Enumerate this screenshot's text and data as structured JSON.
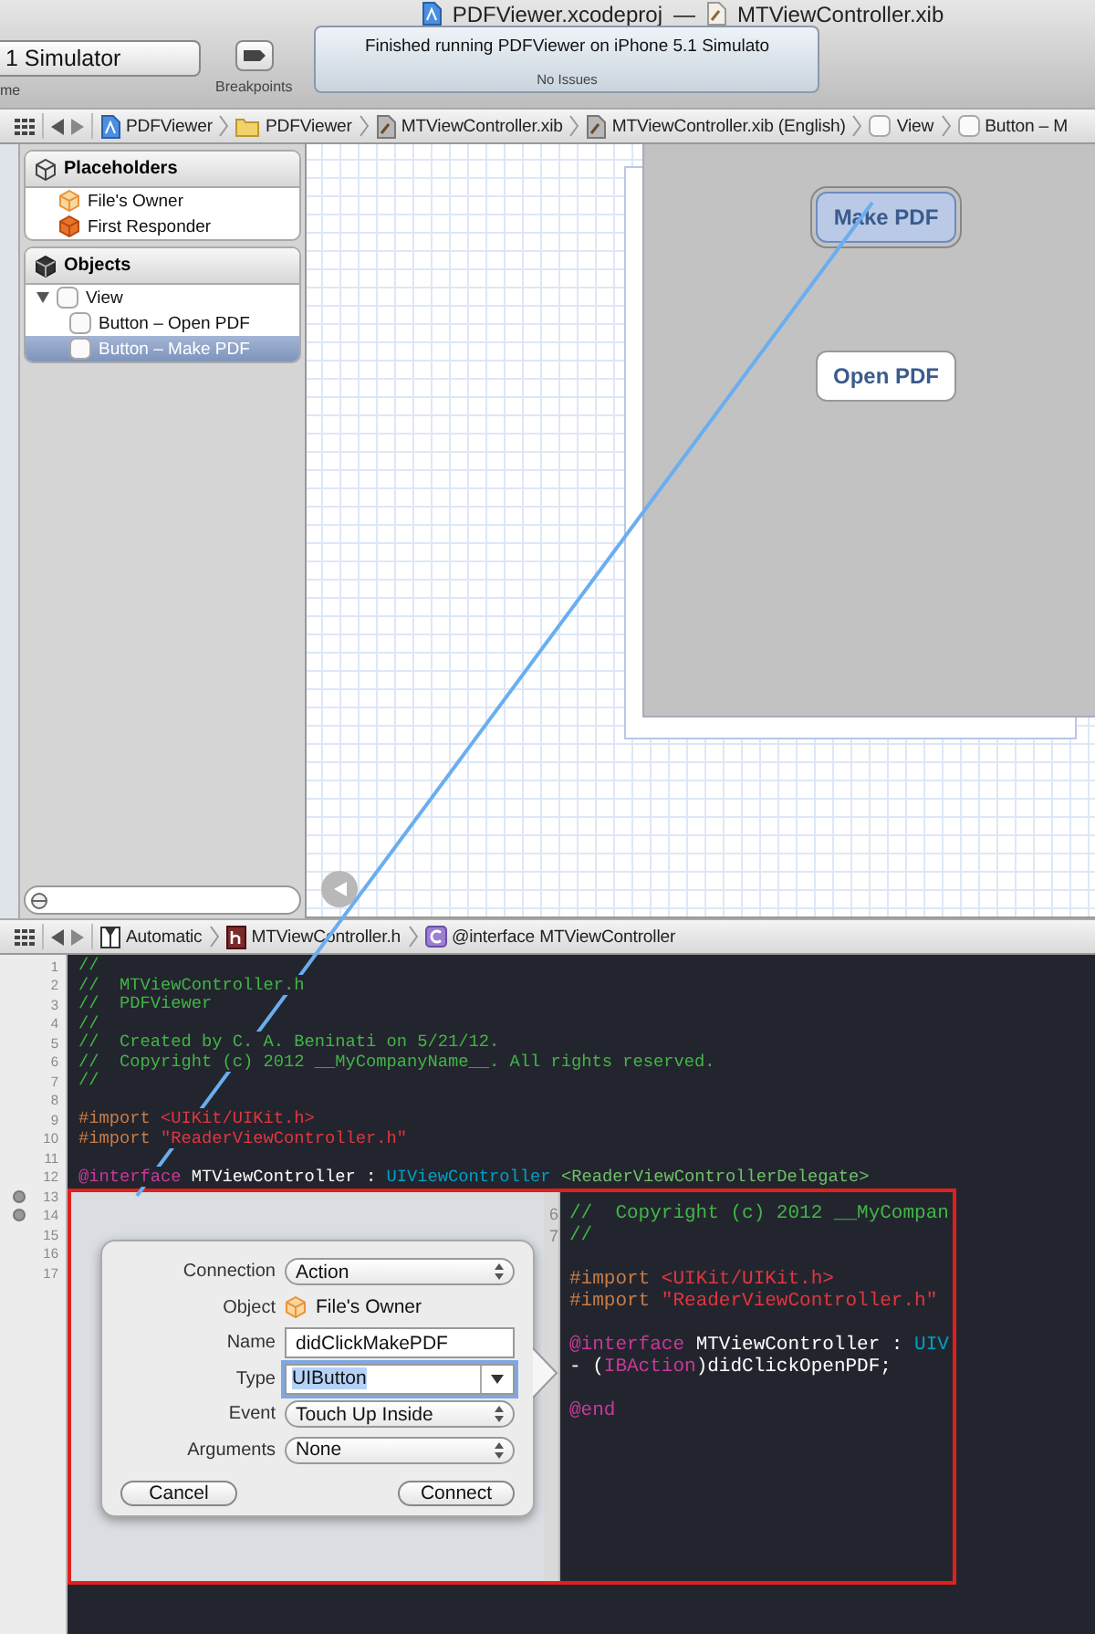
{
  "window": {
    "title_project": "PDFViewer.xcodeproj",
    "title_separator": "—",
    "title_file": "MTViewController.xib"
  },
  "toolbar": {
    "scheme": "1 Simulator",
    "scheme_caption": "me",
    "breakpoints_caption": "Breakpoints",
    "status": {
      "message": "Finished running PDFViewer on iPhone 5.1 Simulato",
      "issues": "No Issues"
    }
  },
  "jump_bar": [
    {
      "label": "PDFViewer"
    },
    {
      "label": "PDFViewer"
    },
    {
      "label": "MTViewController.xib"
    },
    {
      "label": "MTViewController.xib (English)"
    },
    {
      "label": "View"
    },
    {
      "label": "Button – M"
    }
  ],
  "outline": {
    "sections": [
      {
        "title": "Placeholders",
        "items": [
          {
            "label": "File's Owner",
            "selected": false
          },
          {
            "label": "First Responder",
            "selected": false
          }
        ]
      },
      {
        "title": "Objects",
        "items": [
          {
            "label": "View",
            "selected": false,
            "expanded": true,
            "children": [
              {
                "label": "Button – Open PDF",
                "selected": false
              },
              {
                "label": "Button – Make PDF",
                "selected": true
              }
            ]
          }
        ]
      }
    ]
  },
  "canvas": {
    "buttons": [
      {
        "label": "Make PDF",
        "selected": true
      },
      {
        "label": "Open PDF",
        "selected": false
      }
    ]
  },
  "editor_jump_bar": [
    {
      "label": "Automatic"
    },
    {
      "label": "MTViewController.h"
    },
    {
      "label": "@interface MTViewController"
    }
  ],
  "editor": {
    "lines": [
      {
        "number": "1",
        "breakpoint": false,
        "segments": [
          {
            "kind": "comment",
            "text": "//"
          }
        ]
      },
      {
        "number": "2",
        "breakpoint": false,
        "segments": [
          {
            "kind": "comment",
            "text": "//  MTViewController.h"
          }
        ]
      },
      {
        "number": "3",
        "breakpoint": false,
        "segments": [
          {
            "kind": "comment",
            "text": "//  PDFViewer"
          }
        ]
      },
      {
        "number": "4",
        "breakpoint": false,
        "segments": [
          {
            "kind": "comment",
            "text": "//"
          }
        ]
      },
      {
        "number": "5",
        "breakpoint": false,
        "segments": [
          {
            "kind": "comment",
            "text": "//  Created by C. A. Beninati on 5/21/12."
          }
        ]
      },
      {
        "number": "6",
        "breakpoint": false,
        "segments": [
          {
            "kind": "comment",
            "text": "//  Copyright (c) 2012 __MyCompanyName__. All rights reserved."
          }
        ]
      },
      {
        "number": "7",
        "breakpoint": false,
        "segments": [
          {
            "kind": "comment",
            "text": "//"
          }
        ]
      },
      {
        "number": "8",
        "breakpoint": false
      },
      {
        "number": "9",
        "breakpoint": false,
        "segments": [
          {
            "kind": "directive",
            "text": "#import"
          },
          {
            "kind": "string",
            "text": " <UIKit/UIKit.h>"
          }
        ]
      },
      {
        "number": "10",
        "breakpoint": false,
        "segments": [
          {
            "kind": "directive",
            "text": "#import"
          },
          {
            "kind": "string",
            "text": " \"ReaderViewController.h\""
          }
        ]
      },
      {
        "number": "11",
        "breakpoint": false
      },
      {
        "number": "12",
        "breakpoint": false,
        "segments": [
          {
            "kind": "keyword",
            "text": "@interface"
          },
          {
            "kind": "plain",
            "text": " MTViewController : "
          },
          {
            "kind": "class",
            "text": "UIViewController"
          },
          {
            "kind": "protocol",
            "text": " <ReaderViewControllerDelegate>"
          }
        ]
      },
      {
        "number": "13",
        "breakpoint": true
      },
      {
        "number": "14",
        "breakpoint": true
      },
      {
        "number": "15",
        "breakpoint": false
      },
      {
        "number": "16",
        "breakpoint": false
      },
      {
        "number": "17",
        "breakpoint": false
      }
    ]
  },
  "inset": {
    "blocks": [
      {
        "lines": [
          {
            "number": "6",
            "segments": [
              {
                "kind": "comment",
                "text": "//  Copyright (c) 2012 __MyCompan"
              }
            ]
          },
          {
            "number": "7",
            "segments": [
              {
                "kind": "comment",
                "text": "//"
              }
            ]
          }
        ]
      },
      {
        "lines": [
          {
            "segments": [
              {
                "kind": "directive",
                "text": "#import"
              },
              {
                "kind": "string",
                "text": " <UIKit/UIKit.h>"
              }
            ]
          },
          {
            "segments": [
              {
                "kind": "directive",
                "text": "#import"
              },
              {
                "kind": "string",
                "text": " \"ReaderViewController.h\""
              }
            ]
          }
        ]
      },
      {
        "lines": [
          {
            "segments": [
              {
                "kind": "keyword",
                "text": "@interface"
              },
              {
                "kind": "plain",
                "text": " MTViewController : "
              },
              {
                "kind": "class",
                "text": "UIV"
              }
            ]
          },
          {
            "segments": [
              {
                "kind": "plain",
                "text": "- ("
              },
              {
                "kind": "keyword",
                "text": "IBAction"
              },
              {
                "kind": "plain",
                "text": ")didClickOpenPDF;"
              }
            ]
          }
        ]
      },
      {
        "lines": [
          {
            "segments": [
              {
                "kind": "keyword",
                "text": "@end"
              }
            ]
          }
        ]
      }
    ],
    "popover": {
      "rows": [
        {
          "label": "Connection",
          "kind": "popup",
          "value": "Action",
          "focused": false
        },
        {
          "label": "Object",
          "kind": "object",
          "value": "File's Owner",
          "focused": false
        },
        {
          "label": "Name",
          "kind": "text",
          "value": "didClickMakePDF",
          "focused": false
        },
        {
          "label": "Type",
          "kind": "combo",
          "value": "UIButton",
          "focused": true
        },
        {
          "label": "Event",
          "kind": "popup",
          "value": "Touch Up Inside",
          "focused": false
        },
        {
          "label": "Arguments",
          "kind": "popup",
          "value": "None",
          "focused": false
        }
      ],
      "buttons": [
        {
          "label": "Cancel"
        },
        {
          "label": "Connect"
        }
      ]
    }
  }
}
